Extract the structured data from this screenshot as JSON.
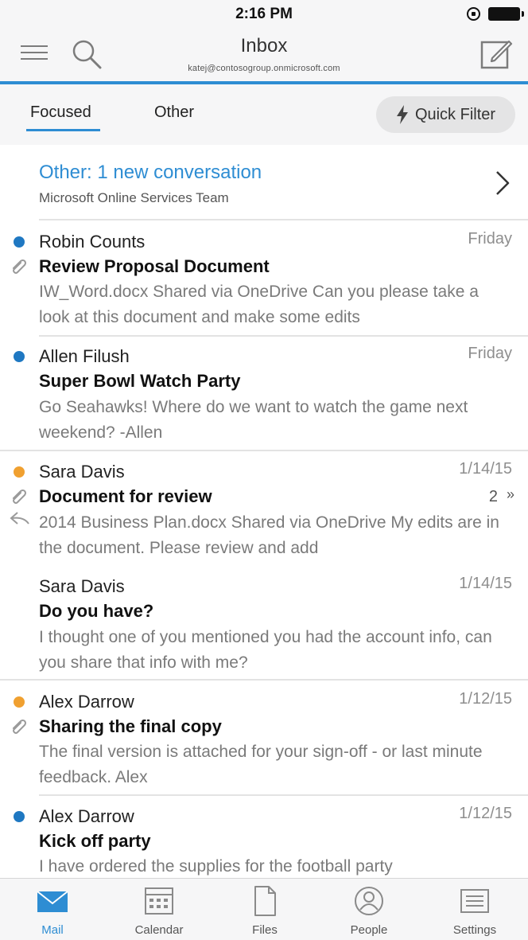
{
  "status": {
    "time": "2:16 PM"
  },
  "header": {
    "title": "Inbox",
    "account": "katej@contosogroup.onmicrosoft.com"
  },
  "tabs": {
    "focused": "Focused",
    "other": "Other",
    "quick_filter": "Quick Filter"
  },
  "other_banner": {
    "title": "Other: 1 new conversation",
    "subtitle": "Microsoft Online Services Team"
  },
  "colors": {
    "accent": "#2e8dd3",
    "unread_dot": "#1f78c2",
    "flag_dot": "#f0a030"
  },
  "messages": [
    {
      "sender": "Robin Counts",
      "date": "Friday",
      "subject": "Review Proposal Document",
      "preview": "IW_Word.docx Shared via OneDrive Can you please take a look at this document and make some edits",
      "dot": "blue",
      "attachment": true
    },
    {
      "sender": "Allen Filush",
      "date": "Friday",
      "subject": "Super Bowl Watch Party",
      "preview": "Go Seahawks! Where do we want to watch the game next weekend? -Allen",
      "dot": "blue"
    },
    {
      "sender": "Sara Davis",
      "date": "1/14/15",
      "subject": "Document for review",
      "preview": "2014 Business Plan.docx Shared via OneDrive  My edits are in the document. Please review and add",
      "dot": "orange",
      "attachment": true,
      "replied": true,
      "count": "2"
    },
    {
      "sender": "Sara Davis",
      "date": "1/14/15",
      "subject": "Do you have?",
      "preview": "I thought one of you mentioned you had the account info, can you share that info with me?"
    },
    {
      "sender": "Alex Darrow",
      "date": "1/12/15",
      "subject": "Sharing the final copy",
      "preview": "The final version is attached for your sign-off - or last minute feedback. Alex",
      "dot": "orange",
      "attachment": true
    },
    {
      "sender": "Alex Darrow",
      "date": "1/12/15",
      "subject": "Kick off party",
      "preview": "I have ordered the supplies for the football party",
      "dot": "blue"
    }
  ],
  "tab_bar": {
    "mail": "Mail",
    "calendar": "Calendar",
    "files": "Files",
    "people": "People",
    "settings": "Settings"
  },
  "icons": [
    "menu-icon",
    "search-icon",
    "compose-icon",
    "bolt-icon",
    "chevron-right-icon",
    "paperclip-icon",
    "reply-icon",
    "mail-icon",
    "calendar-icon",
    "files-icon",
    "people-icon",
    "settings-icon"
  ]
}
